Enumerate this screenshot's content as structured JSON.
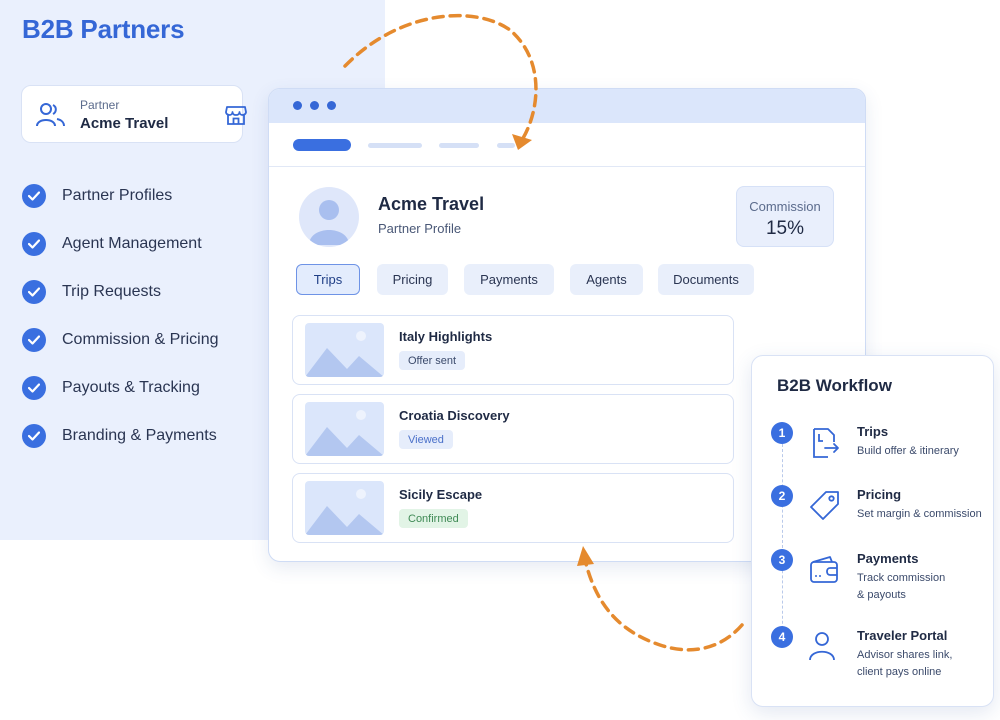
{
  "sidebar": {
    "title": "B2B Partners",
    "partner_card": {
      "label": "Partner",
      "name": "Acme Travel"
    },
    "items": [
      {
        "label": "Partner Profiles"
      },
      {
        "label": "Agent Management"
      },
      {
        "label": "Trip Requests"
      },
      {
        "label": "Commission & Pricing"
      },
      {
        "label": "Payouts & Tracking"
      },
      {
        "label": "Branding & Payments"
      }
    ]
  },
  "profile": {
    "name": "Acme Travel",
    "subtitle": "Partner Profile",
    "commission_label": "Commission",
    "commission_value": "15%"
  },
  "tabs": [
    {
      "label": "Trips",
      "active": true
    },
    {
      "label": "Pricing"
    },
    {
      "label": "Payments"
    },
    {
      "label": "Agents"
    },
    {
      "label": "Documents"
    }
  ],
  "trips": [
    {
      "title": "Italy Highlights",
      "status": "Offer sent"
    },
    {
      "title": "Croatia Discovery",
      "status": "Viewed"
    },
    {
      "title": "Sicily Escape",
      "status": "Confirmed"
    }
  ],
  "workflow": {
    "title": "B2B Workflow",
    "steps": [
      {
        "num": "1",
        "name": "Trips",
        "desc": "Build offer & itinerary",
        "icon": "itinerary-icon"
      },
      {
        "num": "2",
        "name": "Pricing",
        "desc": "Set margin & commission",
        "icon": "price-tag-icon"
      },
      {
        "num": "3",
        "name": "Payments",
        "desc": "Track commission\n& payouts",
        "icon": "wallet-icon"
      },
      {
        "num": "4",
        "name": "Traveler Portal",
        "desc": "Advisor shares link,\nclient pays online",
        "icon": "user-icon"
      }
    ]
  },
  "colors": {
    "primary": "#3567d6",
    "panel_bg": "#eaf0fd",
    "arrow": "#e58a2e",
    "confirmed": "#3f8a55"
  }
}
